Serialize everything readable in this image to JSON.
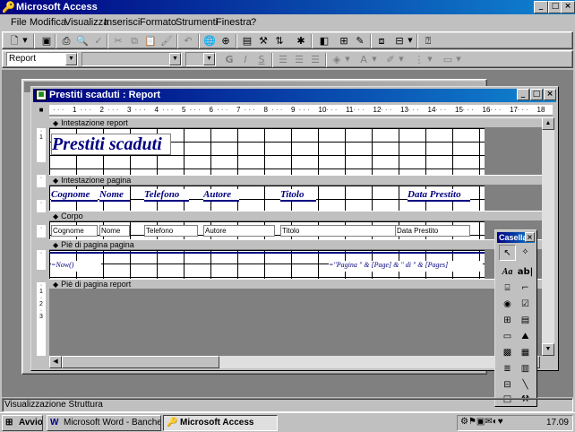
{
  "app": {
    "title": "Microsoft Access",
    "controls": {
      "min": "_",
      "max": "□",
      "close": "×"
    }
  },
  "menu": {
    "items": [
      {
        "label": "File",
        "hot": "F"
      },
      {
        "label": "Modifica",
        "hot": "M"
      },
      {
        "label": "Visualizza",
        "hot": "V"
      },
      {
        "label": "Inserisci",
        "hot": "I"
      },
      {
        "label": "Formato",
        "hot": "o"
      },
      {
        "label": "Strumenti",
        "hot": "S"
      },
      {
        "label": "Finestra",
        "hot": "n"
      },
      {
        "label": "?",
        "hot": "?"
      }
    ]
  },
  "toolbar2": {
    "object_combo": "Report",
    "bold": "G",
    "italic": "I",
    "underline": "S"
  },
  "report": {
    "title": "Prestiti scaduti : Report",
    "ruler_numbers": [
      "1",
      "2",
      "3",
      "4",
      "5",
      "6",
      "7",
      "8",
      "9",
      "10",
      "11",
      "12",
      "13",
      "14",
      "15",
      "16",
      "17",
      "18"
    ],
    "sections": {
      "report_header": "Intestazione report",
      "page_header": "Intestazione pagina",
      "detail": "Corpo",
      "page_footer": "Piè di pagina pagina",
      "report_footer": "Piè di pagina report"
    },
    "report_title": "Prestiti scaduti",
    "column_labels": [
      "Cognome",
      "Nome",
      "Telefono",
      "Autore",
      "Titolo",
      "Data Prestito"
    ],
    "fields": [
      "Cognome",
      "Nome",
      "Telefono",
      "Autore",
      "Titolo",
      "Data Prestito"
    ],
    "footer_date": "=Now()",
    "footer_page": "=\"Pagina \" & [Page] & \" di \" & [Pages]"
  },
  "toolbox": {
    "title": "Casella",
    "tools": [
      "pointer-icon",
      "wizard-icon",
      "label-icon",
      "textbox-icon",
      "option-group-icon",
      "toggle-icon",
      "radio-icon",
      "checkbox-icon",
      "combo-icon",
      "listbox-icon",
      "button-icon",
      "image-icon",
      "unbound-object-icon",
      "bound-object-icon",
      "page-break-icon",
      "subform-icon",
      "line-icon",
      "rectangle-icon",
      "more-controls-icon"
    ]
  },
  "status": {
    "text": "Visualizzazione Struttura"
  },
  "taskbar": {
    "start": "Avvio",
    "tasks": [
      {
        "label": "Microsoft Word - Banche d...",
        "active": false
      },
      {
        "label": "Microsoft Access",
        "active": true
      }
    ],
    "clock": "17.09"
  },
  "colors": {
    "titlebar": "#000080",
    "desktop": "#008080",
    "label_text": "#000080"
  }
}
